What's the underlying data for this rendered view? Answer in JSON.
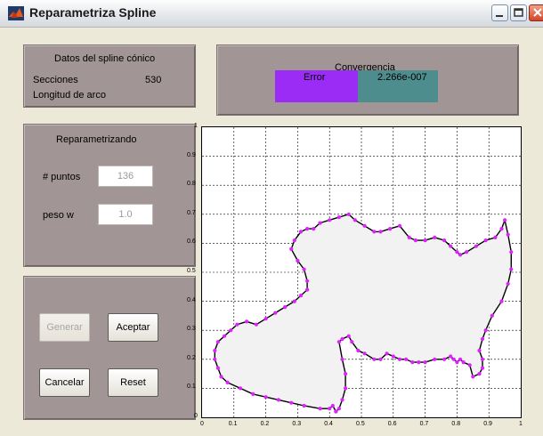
{
  "window": {
    "title": "Reparametriza Spline"
  },
  "spline_panel": {
    "title": "Datos del spline cónico",
    "sections_label": "Secciones",
    "sections_value": "530",
    "arc_length_label": "Longitud de arco"
  },
  "convergence_panel": {
    "title": "Convergencia",
    "error_label": "Error",
    "error_value": "2.266e-007",
    "colors": {
      "error_box": "#9b2cf5",
      "value_box": "#4e8d8e"
    }
  },
  "reparam_panel": {
    "title": "Reparametrizando",
    "points_label": "# puntos",
    "points_value": "136",
    "weight_label": "peso w",
    "weight_value": "1.0"
  },
  "buttons": {
    "generate": "Generar",
    "accept": "Aceptar",
    "cancel": "Cancelar",
    "reset": "Reset"
  },
  "chart_data": {
    "type": "line",
    "xlim": [
      0,
      1
    ],
    "ylim": [
      0,
      1
    ],
    "x_ticks": [
      "0",
      "0.1",
      "0.2",
      "0.3",
      "0.4",
      "0.5",
      "0.6",
      "0.7",
      "0.8",
      "0.9",
      "1"
    ],
    "y_ticks": [
      "0",
      "0.1",
      "0.2",
      "0.3",
      "0.4",
      "0.5",
      "0.6",
      "0.7",
      "0.8",
      "0.9",
      "1"
    ],
    "grid": true,
    "fill_color": "#f2f2f2",
    "line_color": "#000000",
    "marker_color": "#e020ff",
    "series": [
      {
        "x": [
          0.42,
          0.41,
          0.4,
          0.37,
          0.32,
          0.28,
          0.24,
          0.2,
          0.16,
          0.12,
          0.08,
          0.06,
          0.05,
          0.04,
          0.04,
          0.05,
          0.07,
          0.09,
          0.11,
          0.14,
          0.17,
          0.2,
          0.23,
          0.26,
          0.29,
          0.31,
          0.33,
          0.33,
          0.32,
          0.3,
          0.28,
          0.29,
          0.31,
          0.33,
          0.35,
          0.37,
          0.4,
          0.43,
          0.46,
          0.48,
          0.51,
          0.54,
          0.56,
          0.59,
          0.62,
          0.65,
          0.67,
          0.7,
          0.73,
          0.76,
          0.78,
          0.8,
          0.81,
          0.83,
          0.86,
          0.89,
          0.92,
          0.94,
          0.95,
          0.96,
          0.97,
          0.97,
          0.96,
          0.94,
          0.91,
          0.89,
          0.88,
          0.87,
          0.88,
          0.88,
          0.87,
          0.85,
          0.84,
          0.82,
          0.81,
          0.8,
          0.79,
          0.78,
          0.76,
          0.73,
          0.7,
          0.68,
          0.66,
          0.64,
          0.62,
          0.6,
          0.58,
          0.56,
          0.54,
          0.51,
          0.49,
          0.47,
          0.46,
          0.44,
          0.43,
          0.44,
          0.45,
          0.45,
          0.44,
          0.43,
          0.42
        ],
        "y": [
          0.02,
          0.04,
          0.03,
          0.03,
          0.04,
          0.05,
          0.06,
          0.07,
          0.08,
          0.1,
          0.12,
          0.14,
          0.17,
          0.2,
          0.23,
          0.26,
          0.28,
          0.3,
          0.32,
          0.33,
          0.32,
          0.34,
          0.36,
          0.38,
          0.4,
          0.42,
          0.44,
          0.47,
          0.51,
          0.54,
          0.58,
          0.61,
          0.64,
          0.65,
          0.65,
          0.67,
          0.68,
          0.69,
          0.7,
          0.68,
          0.66,
          0.64,
          0.64,
          0.65,
          0.66,
          0.62,
          0.61,
          0.61,
          0.62,
          0.61,
          0.59,
          0.57,
          0.56,
          0.57,
          0.59,
          0.61,
          0.62,
          0.65,
          0.68,
          0.63,
          0.57,
          0.51,
          0.46,
          0.4,
          0.35,
          0.3,
          0.27,
          0.23,
          0.2,
          0.17,
          0.15,
          0.14,
          0.18,
          0.19,
          0.2,
          0.19,
          0.2,
          0.21,
          0.2,
          0.2,
          0.19,
          0.19,
          0.19,
          0.2,
          0.2,
          0.21,
          0.22,
          0.2,
          0.2,
          0.22,
          0.23,
          0.26,
          0.28,
          0.27,
          0.26,
          0.2,
          0.15,
          0.1,
          0.06,
          0.03,
          0.02
        ]
      }
    ]
  }
}
